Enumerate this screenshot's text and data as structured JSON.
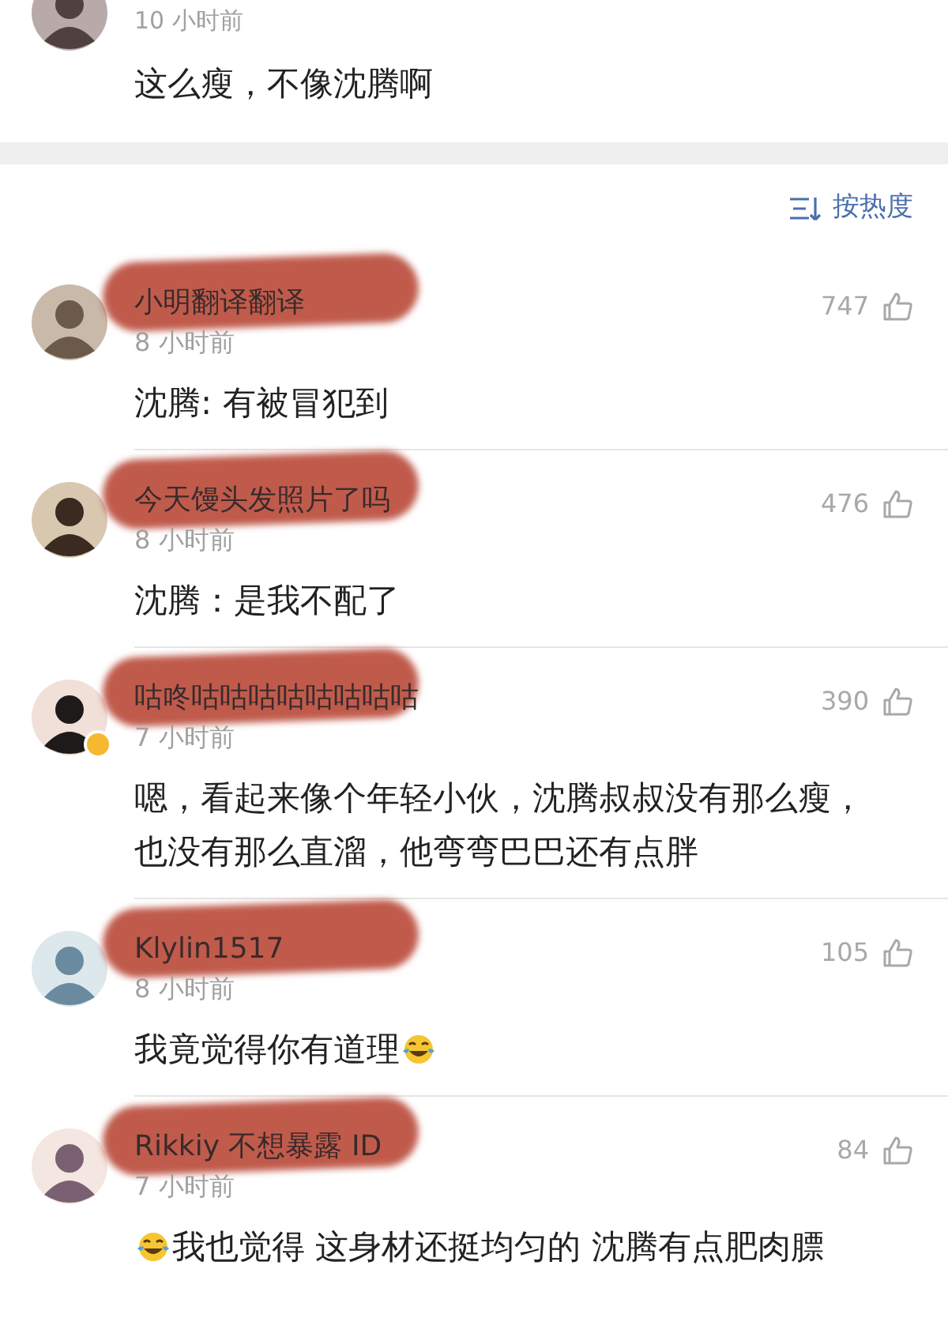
{
  "top_comment": {
    "time": "10 小时前",
    "text": "这么瘦，不像沈腾啊"
  },
  "sort": {
    "label": "按热度"
  },
  "comments": [
    {
      "user": "小明翻译翻译",
      "redacted": true,
      "verified": false,
      "time": "8 小时前",
      "likes": "747",
      "text": "沈腾: 有被冒犯到"
    },
    {
      "user": "今天馒头发照片了吗",
      "redacted": true,
      "verified": false,
      "time": "8 小时前",
      "likes": "476",
      "text": "沈腾：是我不配了"
    },
    {
      "user": "咕咚咕咕咕咕咕咕咕咕",
      "redacted": true,
      "verified": true,
      "time": "7 小时前",
      "likes": "390",
      "text": "嗯，看起来像个年轻小伙，沈腾叔叔没有那么瘦，也没有那么直溜，他弯弯巴巴还有点胖"
    },
    {
      "user": "Klylin1517",
      "redacted": true,
      "verified": false,
      "time": "8 小时前",
      "likes": "105",
      "segments": [
        {
          "kind": "text",
          "text": "我竟觉得你有道理"
        },
        {
          "kind": "emoji"
        }
      ]
    },
    {
      "user": "Rikkiy 不想暴露 ID",
      "redacted": true,
      "verified": false,
      "time": "7 小时前",
      "likes": "84",
      "segments": [
        {
          "kind": "emoji"
        },
        {
          "kind": "text",
          "text": "我也觉得 这身材还挺均匀的 沈腾有点肥肉膘"
        }
      ]
    }
  ]
}
